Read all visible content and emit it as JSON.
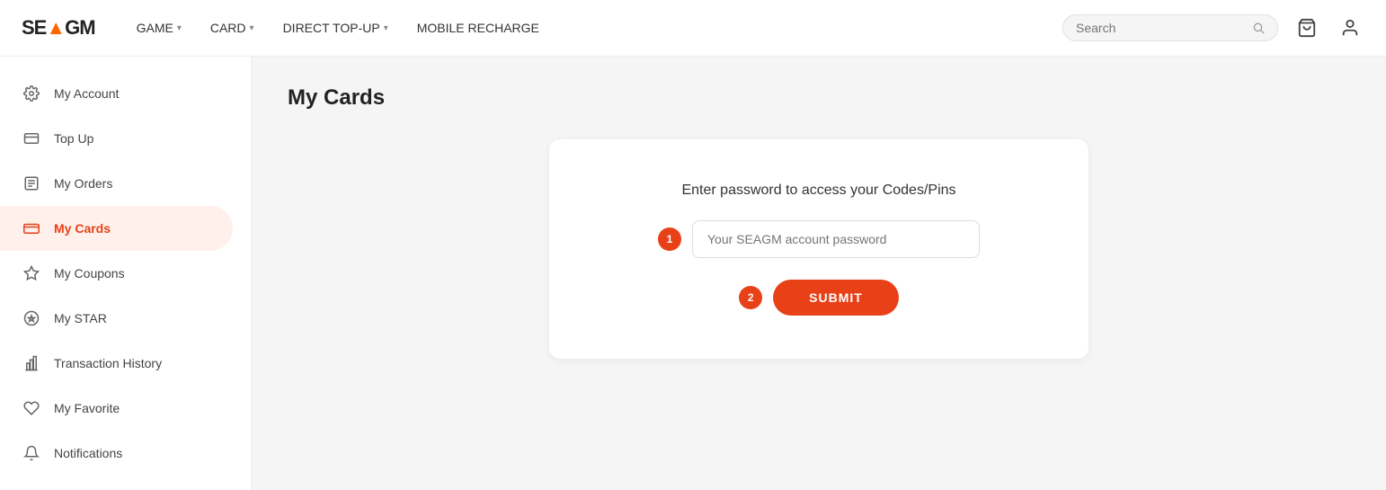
{
  "site": {
    "logo": "SE▲GM",
    "logo_prefix": "SE",
    "logo_accent": "▲",
    "logo_suffix": "GM"
  },
  "nav": {
    "items": [
      {
        "label": "GAME",
        "hasDropdown": true
      },
      {
        "label": "CARD",
        "hasDropdown": true
      },
      {
        "label": "DIRECT TOP-UP",
        "hasDropdown": true
      },
      {
        "label": "MOBILE RECHARGE",
        "hasDropdown": false
      }
    ]
  },
  "header": {
    "search_placeholder": "Search",
    "cart_label": "Cart",
    "user_label": "User"
  },
  "sidebar": {
    "items": [
      {
        "id": "account",
        "label": "My Account",
        "icon": "gear"
      },
      {
        "id": "topup",
        "label": "Top Up",
        "icon": "topup"
      },
      {
        "id": "orders",
        "label": "My Orders",
        "icon": "orders"
      },
      {
        "id": "cards",
        "label": "My Cards",
        "icon": "cards",
        "active": true
      },
      {
        "id": "coupons",
        "label": "My Coupons",
        "icon": "coupons"
      },
      {
        "id": "star",
        "label": "My STAR",
        "icon": "star"
      },
      {
        "id": "history",
        "label": "Transaction History",
        "icon": "history"
      },
      {
        "id": "favorite",
        "label": "My Favorite",
        "icon": "favorite"
      },
      {
        "id": "notifications",
        "label": "Notifications",
        "icon": "notif"
      }
    ]
  },
  "main": {
    "page_title": "My Cards",
    "card_panel": {
      "title": "Enter password to access your Codes/Pins",
      "password_placeholder": "Your SEAGM account password",
      "step1_badge": "1",
      "step2_badge": "2",
      "submit_label": "SUBMIT"
    }
  }
}
